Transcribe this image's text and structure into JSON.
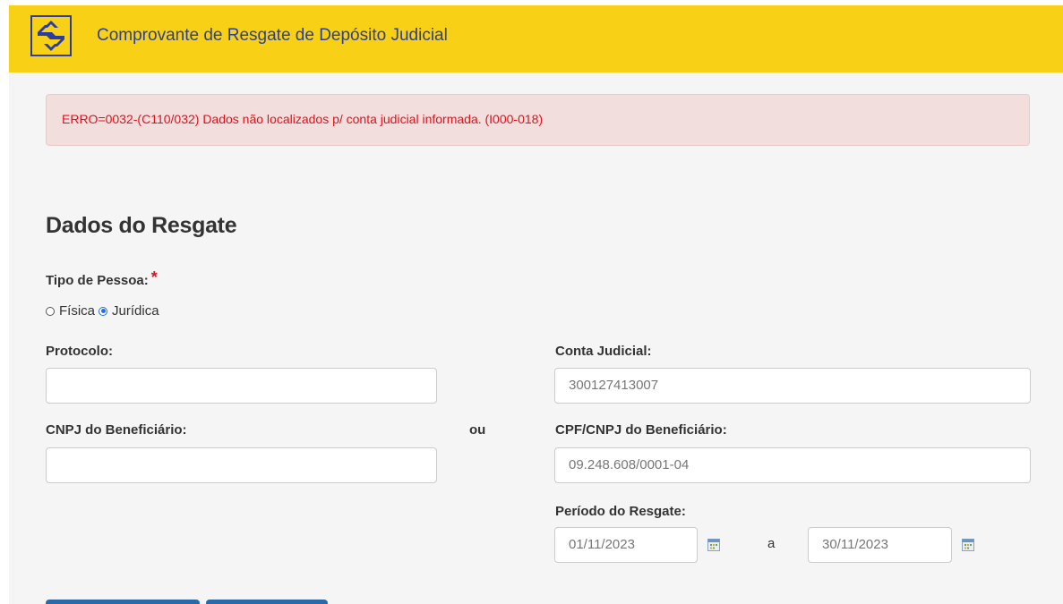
{
  "header": {
    "title": "Comprovante de Resgate de Depósito Judicial",
    "logo_icon": "banco-do-brasil-logo-icon"
  },
  "alert": {
    "message": "ERRO=0032-(C110/032) Dados não localizados p/ conta judicial informada. (I000-018)"
  },
  "form": {
    "section_title": "Dados do Resgate",
    "tipo_pessoa": {
      "label": "Tipo de Pessoa:",
      "required_mark": "*",
      "options": [
        {
          "label": "Física",
          "checked": false
        },
        {
          "label": "Jurídica",
          "checked": true
        }
      ]
    },
    "protocolo": {
      "label": "Protocolo:",
      "value": ""
    },
    "cnpj_beneficiario": {
      "label": "CNPJ do Beneficiário:",
      "value": ""
    },
    "separator": "ou",
    "conta_judicial": {
      "label": "Conta Judicial:",
      "value": "300127413007"
    },
    "cpf_cnpj_beneficiario": {
      "label": "CPF/CNPJ do Beneficiário:",
      "value": "09.248.608/0001-04"
    },
    "periodo": {
      "label": "Período do Resgate:",
      "start": "01/11/2023",
      "end": "30/11/2023",
      "range_separator": "a",
      "calendar_icon": "calendar-icon"
    }
  },
  "colors": {
    "header_bg": "#f8d117",
    "header_text": "#2d3f8e",
    "error_text": "#e0121b",
    "error_bg": "#f3dede",
    "button_bg": "#2a6aa8"
  }
}
